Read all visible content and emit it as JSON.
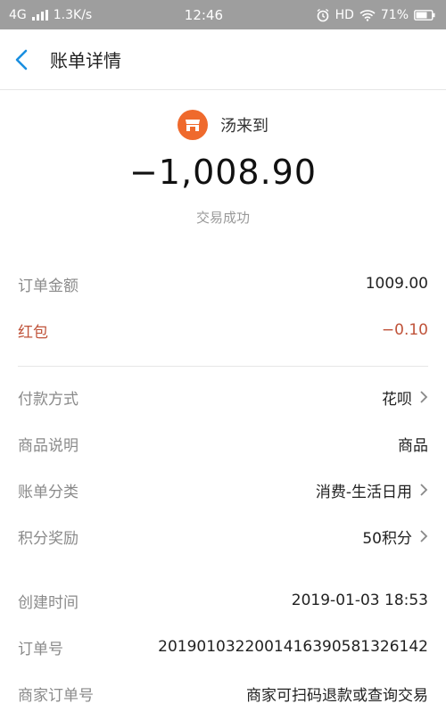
{
  "status_bar": {
    "network": "4G",
    "speed": "1.3K/s",
    "time": "12:46",
    "hd": "HD",
    "battery": "71%"
  },
  "nav": {
    "title": "账单详情"
  },
  "merchant": {
    "name": "汤来到",
    "amount": "−1,008.90",
    "status": "交易成功"
  },
  "amounts": [
    {
      "label": "订单金额",
      "value": "1009.00"
    },
    {
      "label": "红包",
      "value": "−0.10"
    }
  ],
  "details": [
    {
      "label": "付款方式",
      "value": "花呗"
    },
    {
      "label": "商品说明",
      "value": "商品"
    },
    {
      "label": "账单分类",
      "value": "消费-生活日用"
    },
    {
      "label": "积分奖励",
      "value": "50积分"
    }
  ],
  "meta": [
    {
      "label": "创建时间",
      "value": "2019-01-03 18:53"
    },
    {
      "label": "订单号",
      "value": "20190103220014163905813261­42"
    },
    {
      "label": "商家订单号",
      "value": "商家可扫码退款或查询交易"
    }
  ],
  "colors": {
    "status_bar": "#9e9e9e",
    "back_arrow": "#1a8fe0",
    "merchant_logo": "#ef6a2d",
    "red_packet": "#c0533a"
  },
  "icons": {
    "back": "chevron-left-icon",
    "merchant": "shop-icon",
    "arrow": "chevron-right-icon"
  }
}
